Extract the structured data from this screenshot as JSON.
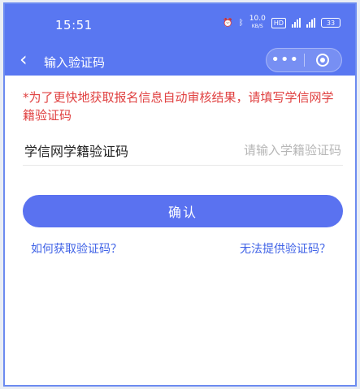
{
  "status_bar": {
    "time": "15:51",
    "speed_value": "10.0",
    "speed_unit": "KB/S",
    "hd_label": "HD",
    "battery": "33"
  },
  "navbar": {
    "back_icon": "chevron-left-icon",
    "title": "输入验证码",
    "more_icon": "more-dots-icon",
    "close_icon": "target-circle-icon"
  },
  "form": {
    "notice": "*为了更快地获取报名信息自动审核结果，请填写学信网学籍验证码",
    "field_label": "学信网学籍验证码",
    "field_value": "",
    "field_placeholder": "请输入学籍验证码",
    "confirm_label": "确认"
  },
  "links": {
    "how_to_get": "如何获取验证码？",
    "cannot_provide": "无法提供验证码？"
  },
  "colors": {
    "header_bg": "#5977f1",
    "button_bg": "#5a72f0",
    "notice_text": "#e04141",
    "link_text": "#3f62e6"
  }
}
